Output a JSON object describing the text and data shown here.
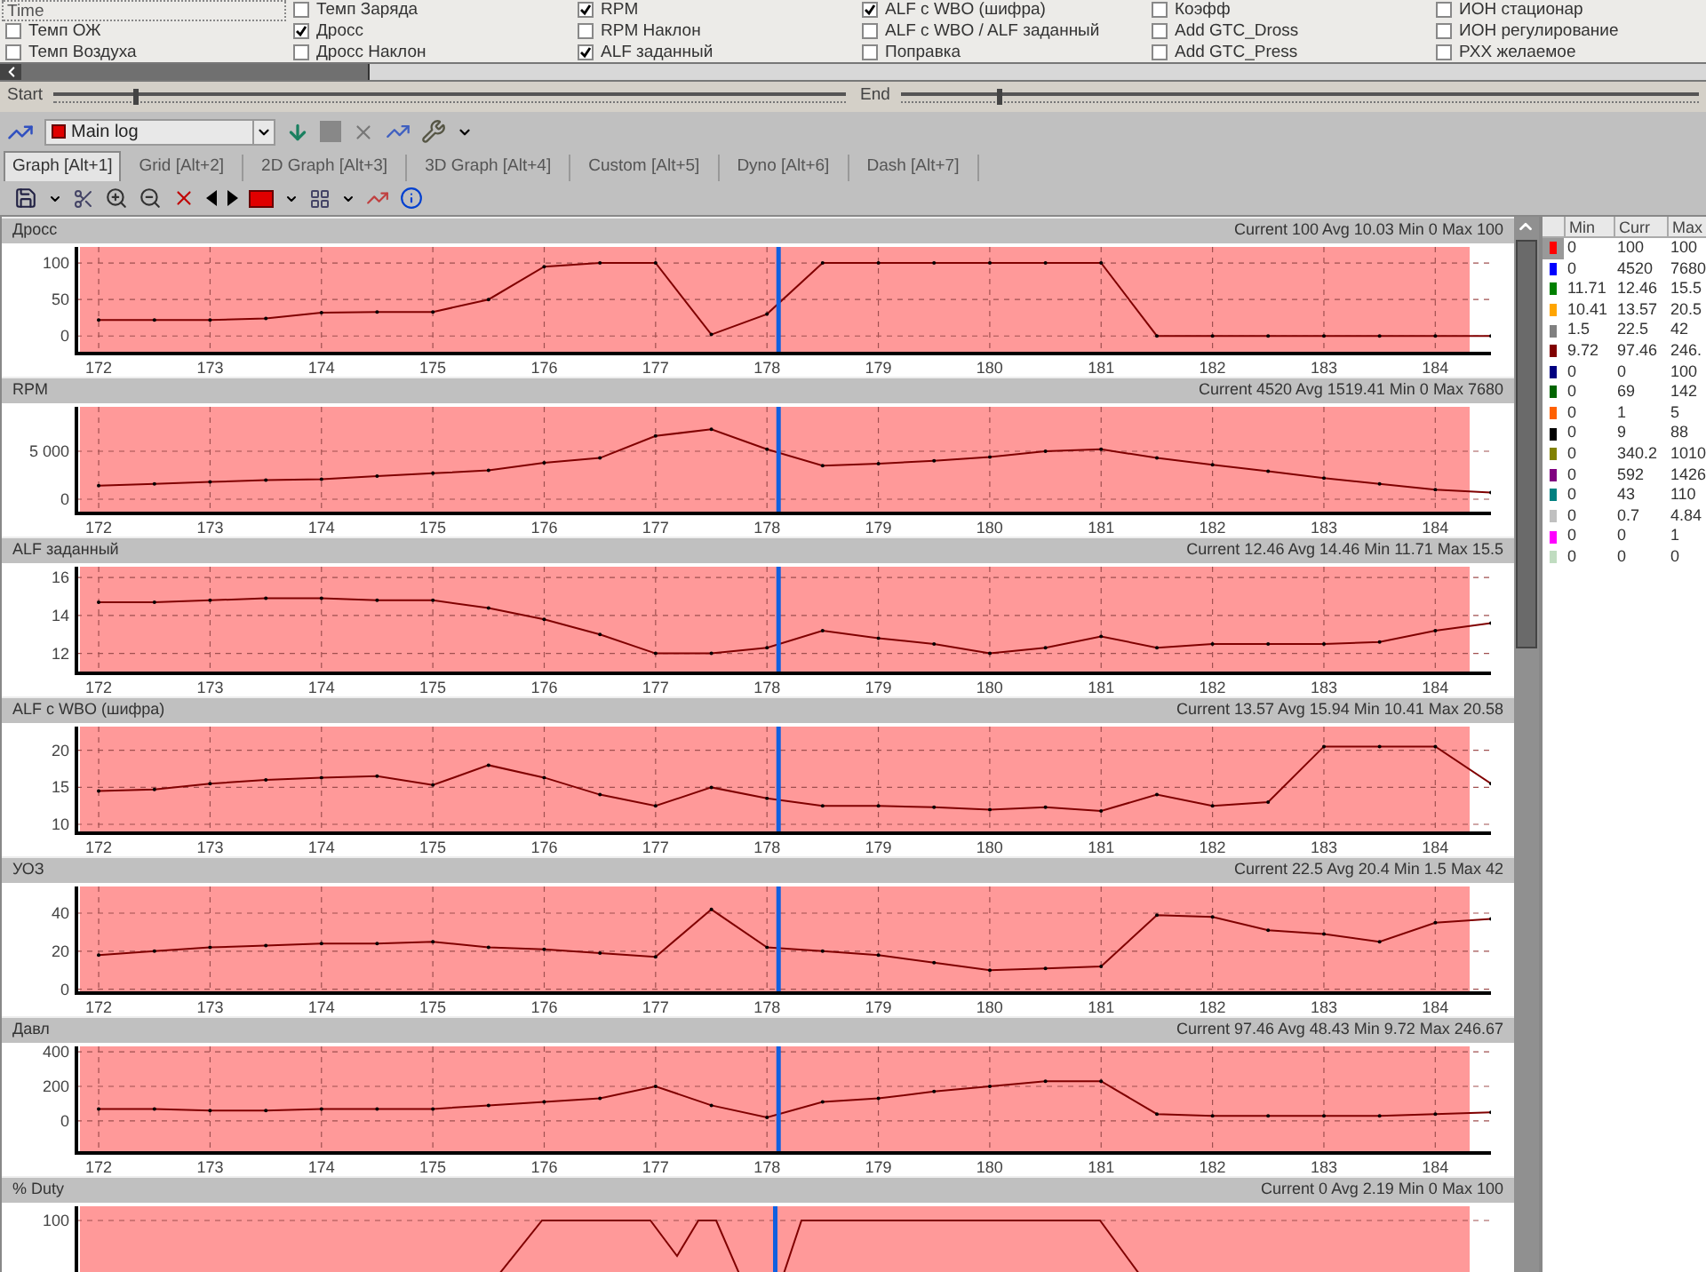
{
  "signals": [
    {
      "kind": "header",
      "label": "Time"
    },
    {
      "kind": "check",
      "label": "Темп Заряда",
      "checked": false
    },
    {
      "kind": "check",
      "label": "RPM",
      "checked": true
    },
    {
      "kind": "check",
      "label": "ALF с WBO (шифра)",
      "checked": true
    },
    {
      "kind": "check",
      "label": "Коэфф",
      "checked": false
    },
    {
      "kind": "check",
      "label": "ИОН стационар",
      "checked": false
    },
    {
      "kind": "check",
      "label": "Темп ОЖ",
      "checked": false
    },
    {
      "kind": "check",
      "label": "Дросс",
      "checked": true
    },
    {
      "kind": "check",
      "label": "RPM Наклон",
      "checked": false
    },
    {
      "kind": "check",
      "label": "ALF с WBO / ALF заданный",
      "checked": false
    },
    {
      "kind": "check",
      "label": "Add GTC_Dross",
      "checked": false
    },
    {
      "kind": "check",
      "label": "ИОН регулирование",
      "checked": false
    },
    {
      "kind": "check",
      "label": "Темп Воздуха",
      "checked": false
    },
    {
      "kind": "check",
      "label": "Дросс Наклон",
      "checked": false
    },
    {
      "kind": "check",
      "label": "ALF заданный",
      "checked": true
    },
    {
      "kind": "check",
      "label": "Поправка",
      "checked": false
    },
    {
      "kind": "check",
      "label": "Add GTC_Press",
      "checked": false
    },
    {
      "kind": "check",
      "label": "РХХ желаемое",
      "checked": false
    }
  ],
  "range": {
    "start": {
      "label": "Start",
      "level": 0.1
    },
    "end": {
      "label": "End",
      "level": 0.12
    }
  },
  "log_select": {
    "value": "Main log"
  },
  "tabs": [
    {
      "label": "Graph [Alt+1]",
      "selected": true
    },
    {
      "label": "Grid [Alt+2]",
      "selected": false
    },
    {
      "label": "2D Graph [Alt+3]",
      "selected": false
    },
    {
      "label": "3D Graph [Alt+4]",
      "selected": false
    },
    {
      "label": "Custom [Alt+5]",
      "selected": false
    },
    {
      "label": "Dyno [Alt+6]",
      "selected": false
    },
    {
      "label": "Dash [Alt+7]",
      "selected": false
    }
  ],
  "panels": [
    {
      "stats": "Current 100 Avg 10.03 Min 0 Max 100",
      "chart_data": {
        "type": "line",
        "x": [
          172,
          172.5,
          173,
          173.5,
          174,
          174.5,
          175,
          175.5,
          176,
          176.5,
          177,
          177.5,
          178,
          178.5,
          179,
          179.5,
          180,
          180.5,
          181,
          181.5,
          182,
          182.5,
          183,
          183.5,
          184,
          184.5
        ],
        "series": [
          {
            "name": "Дросс",
            "color": "#800000",
            "values": [
              22,
              22,
              22,
              24,
              32,
              33,
              33,
              50,
              95,
              100,
              100,
              2,
              30,
              100,
              100,
              100,
              100,
              100,
              100,
              0,
              0,
              0,
              0,
              0,
              0,
              0
            ]
          }
        ],
        "xlim": [
          171.8,
          184.5
        ],
        "ylim": [
          -24,
          122
        ],
        "xticks": [
          172,
          173,
          174,
          175,
          176,
          177,
          178,
          179,
          180,
          181,
          182,
          183,
          184
        ],
        "yticks": [
          0,
          50,
          100
        ],
        "grid": true,
        "ref_lines": [
          {
            "axis": "x",
            "value": 178.1
          }
        ]
      }
    },
    {
      "stats": "Current 4520 Avg 1519.41 Min 0 Max 7680",
      "chart_data": {
        "type": "line",
        "x": [
          172,
          172.5,
          173,
          173.5,
          174,
          174.5,
          175,
          175.5,
          176,
          176.5,
          177,
          177.5,
          178,
          178.5,
          179,
          179.5,
          180,
          180.5,
          181,
          181.5,
          182,
          182.5,
          183,
          183.5,
          184,
          184.5
        ],
        "series": [
          {
            "name": "RPM",
            "color": "#800000",
            "values": [
              1400,
              1600,
              1800,
              2000,
              2100,
              2400,
              2700,
              3000,
              3800,
              4300,
              6600,
              7300,
              5200,
              3500,
              3700,
              4000,
              4400,
              5000,
              5200,
              4300,
              3600,
              2900,
              2200,
              1600,
              1000,
              700
            ]
          }
        ],
        "xlim": [
          171.8,
          184.5
        ],
        "ylim": [
          -1480,
          9630
        ],
        "xticks": [
          172,
          173,
          174,
          175,
          176,
          177,
          178,
          179,
          180,
          181,
          182,
          183,
          184
        ],
        "yticks": [
          0,
          {
            "value": 5000,
            "label": "5 000"
          }
        ],
        "grid": true,
        "ref_lines": [
          {
            "axis": "x",
            "value": 178.1
          }
        ]
      }
    },
    {
      "stats": "Current 12.46 Avg 14.46 Min 11.71 Max 15.5",
      "chart_data": {
        "type": "line",
        "x": [
          172,
          172.5,
          173,
          173.5,
          174,
          174.5,
          175,
          175.5,
          176,
          176.5,
          177,
          177.5,
          178,
          178.5,
          179,
          179.5,
          180,
          180.5,
          181,
          181.5,
          182,
          182.5,
          183,
          183.5,
          184,
          184.5
        ],
        "series": [
          {
            "name": "ALF заданный",
            "color": "#800000",
            "values": [
              14.7,
              14.7,
              14.8,
              14.9,
              14.9,
              14.8,
              14.8,
              14.4,
              13.8,
              13.0,
              12.0,
              12.0,
              12.3,
              13.2,
              12.8,
              12.5,
              12.0,
              12.3,
              12.9,
              12.3,
              12.5,
              12.5,
              12.5,
              12.6,
              13.2,
              13.6
            ]
          }
        ],
        "xlim": [
          171.8,
          184.5
        ],
        "ylim": [
          10.95,
          16.57
        ],
        "xticks": [
          172,
          173,
          174,
          175,
          176,
          177,
          178,
          179,
          180,
          181,
          182,
          183,
          184
        ],
        "yticks": [
          12,
          14,
          16
        ],
        "grid": true,
        "ref_lines": [
          {
            "axis": "x",
            "value": 178.1
          }
        ]
      }
    },
    {
      "stats": "Current 13.57 Avg 15.94 Min 10.41 Max 20.58",
      "chart_data": {
        "type": "line",
        "x": [
          172,
          172.5,
          173,
          173.5,
          174,
          174.5,
          175,
          175.5,
          176,
          176.5,
          177,
          177.5,
          178,
          178.5,
          179,
          179.5,
          180,
          180.5,
          181,
          181.5,
          182,
          182.5,
          183,
          183.5,
          184,
          184.5
        ],
        "series": [
          {
            "name": "ALF с WBO (шифра)",
            "color": "#800000",
            "values": [
              14.5,
              14.7,
              15.5,
              16.0,
              16.3,
              16.5,
              15.3,
              18,
              16.3,
              14,
              12.5,
              15,
              13.5,
              12.5,
              12.5,
              12.3,
              12,
              12.3,
              11.8,
              14,
              12.5,
              13,
              20.5,
              20.5,
              20.5,
              15.5
            ]
          }
        ],
        "xlim": [
          171.8,
          184.5
        ],
        "ylim": [
          8.8,
          23.2
        ],
        "xticks": [
          172,
          173,
          174,
          175,
          176,
          177,
          178,
          179,
          180,
          181,
          182,
          183,
          184
        ],
        "yticks": [
          10,
          15,
          20
        ],
        "grid": true,
        "ref_lines": [
          {
            "axis": "x",
            "value": 178.1
          }
        ]
      }
    },
    {
      "stats": "Current 22.5 Avg 20.4 Min 1.5 Max 42",
      "chart_data": {
        "type": "line",
        "x": [
          172,
          172.5,
          173,
          173.5,
          174,
          174.5,
          175,
          175.5,
          176,
          176.5,
          177,
          177.5,
          178,
          178.5,
          179,
          179.5,
          180,
          180.5,
          181,
          181.5,
          182,
          182.5,
          183,
          183.5,
          184,
          184.5
        ],
        "series": [
          {
            "name": "УОЗ",
            "color": "#800000",
            "values": [
              18,
              20,
              22,
              23,
              24,
              24,
              25,
              22,
              21,
              19,
              17,
              42,
              22,
              20,
              18,
              14,
              10,
              11,
              12,
              39,
              38,
              31,
              29,
              25,
              35,
              37
            ]
          }
        ],
        "xlim": [
          171.8,
          184.5
        ],
        "ylim": [
          -2,
          54
        ],
        "xticks": [
          172,
          173,
          174,
          175,
          176,
          177,
          178,
          179,
          180,
          181,
          182,
          183,
          184
        ],
        "yticks": [
          0,
          20,
          40
        ],
        "grid": true,
        "ref_lines": [
          {
            "axis": "x",
            "value": 178.1
          }
        ]
      }
    },
    {
      "stats": "Current 97.46 Avg 48.43 Min 9.72 Max 246.67",
      "chart_data": {
        "type": "line",
        "x": [
          172,
          172.5,
          173,
          173.5,
          174,
          174.5,
          175,
          175.5,
          176,
          176.5,
          177,
          177.5,
          178,
          178.5,
          179,
          179.5,
          180,
          180.5,
          181,
          181.5,
          182,
          182.5,
          183,
          183.5,
          184,
          184.5
        ],
        "series": [
          {
            "name": "Давл",
            "color": "#800000",
            "values": [
              70,
              70,
              60,
              60,
              70,
              70,
              70,
              90,
              110,
              130,
              200,
              90,
              20,
              110,
              130,
              170,
              200,
              230,
              230,
              40,
              30,
              30,
              30,
              30,
              40,
              50
            ]
          }
        ],
        "xlim": [
          171.8,
          184.5
        ],
        "ylim": [
          -185,
          431
        ],
        "xticks": [
          172,
          173,
          174,
          175,
          176,
          177,
          178,
          179,
          180,
          181,
          182,
          183,
          184
        ],
        "yticks": [
          0,
          200,
          400
        ],
        "grid": true,
        "ref_lines": [
          {
            "axis": "x",
            "value": 178.1
          }
        ]
      }
    },
    {
      "title": "% Duty",
      "stats": "Current 0 Avg 2.19 Min 0 Max 100",
      "tick_label": "100"
    }
  ],
  "stats_table": {
    "columns": [
      "Min",
      "Curr",
      "Max"
    ],
    "rows": [
      {
        "color": "#ff0000",
        "selected": true,
        "min": "0",
        "curr": "100",
        "max": "100"
      },
      {
        "color": "#0000ff",
        "selected": false,
        "min": "0",
        "curr": "4520",
        "max": "7680"
      },
      {
        "color": "#008000",
        "selected": false,
        "min": "11.71",
        "curr": "12.46",
        "max": "15.5"
      },
      {
        "color": "#ffa500",
        "selected": false,
        "min": "10.41",
        "curr": "13.57",
        "max": "20.5"
      },
      {
        "color": "#808080",
        "selected": false,
        "min": "1.5",
        "curr": "22.5",
        "max": "42"
      },
      {
        "color": "#800000",
        "selected": false,
        "min": "9.72",
        "curr": "97.46",
        "max": "246."
      },
      {
        "color": "#000080",
        "selected": false,
        "min": "0",
        "curr": "0",
        "max": "100"
      },
      {
        "color": "#006400",
        "selected": false,
        "min": "0",
        "curr": "69",
        "max": "142"
      },
      {
        "color": "#ff6000",
        "selected": false,
        "min": "0",
        "curr": "1",
        "max": "5"
      },
      {
        "color": "#000000",
        "selected": false,
        "min": "0",
        "curr": "9",
        "max": "88"
      },
      {
        "color": "#808000",
        "selected": false,
        "min": "0",
        "curr": "340.2",
        "max": "1010"
      },
      {
        "color": "#800080",
        "selected": false,
        "min": "0",
        "curr": "592",
        "max": "1426"
      },
      {
        "color": "#008080",
        "selected": false,
        "min": "0",
        "curr": "43",
        "max": "110"
      },
      {
        "color": "#c0c0c0",
        "selected": false,
        "min": "0",
        "curr": "0.7",
        "max": "4.84"
      },
      {
        "color": "#ff00ff",
        "selected": false,
        "min": "0",
        "curr": "0",
        "max": "1"
      },
      {
        "color": "#c0dcc0",
        "selected": false,
        "min": "0",
        "curr": "0",
        "max": "0"
      }
    ]
  }
}
